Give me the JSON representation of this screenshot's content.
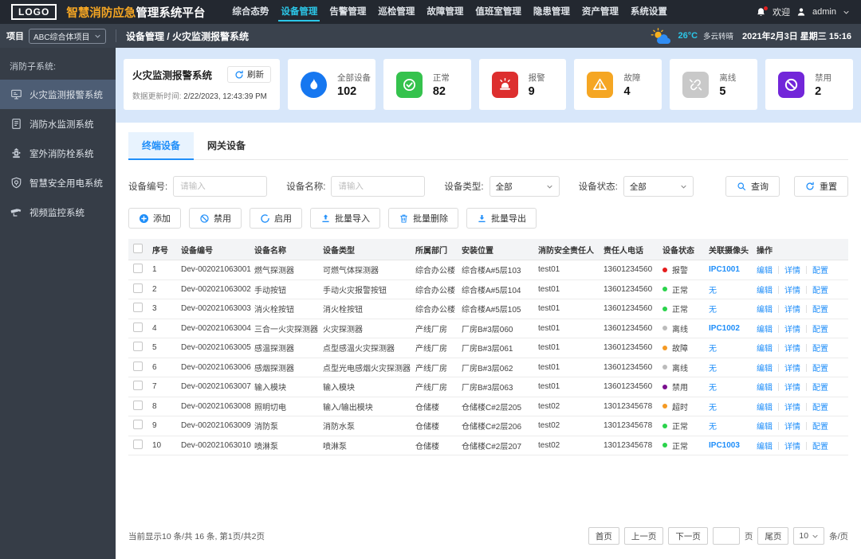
{
  "topnav": {
    "logo": "LOGO",
    "brand_accent": "智慧消防应急",
    "brand_rest": "管理系统平台",
    "menu": [
      {
        "label": "综合态势"
      },
      {
        "label": "设备管理",
        "active": true
      },
      {
        "label": "告警管理"
      },
      {
        "label": "巡检管理"
      },
      {
        "label": "故障管理"
      },
      {
        "label": "值班室管理"
      },
      {
        "label": "隐患管理"
      },
      {
        "label": "资产管理"
      },
      {
        "label": "系统设置"
      }
    ],
    "welcome": "欢迎",
    "username": "admin"
  },
  "subbar": {
    "project_label": "项目",
    "project_value": "ABC综合体项目",
    "breadcrumb": "设备管理 / 火灾监测报警系统",
    "weather_temp": "26°C",
    "weather_desc": "多云转晴",
    "datetime": "2021年2月3日 星期三 15:16"
  },
  "sidebar": {
    "section_label": "消防子系统:",
    "items": [
      {
        "label": "火灾监测报警系统",
        "icon": "monitor",
        "active": true
      },
      {
        "label": "消防水监测系统",
        "icon": "doc"
      },
      {
        "label": "室外消防栓系统",
        "icon": "hydrant"
      },
      {
        "label": "智慧安全用电系统",
        "icon": "shield"
      },
      {
        "label": "视频监控系统",
        "icon": "camera"
      }
    ]
  },
  "overview": {
    "title": "火灾监测报警系统",
    "refresh_label": "刷新",
    "update_label": "数据更新时间:",
    "update_time": "2/22/2023, 12:43:39 PM",
    "stats": [
      {
        "label": "全部设备",
        "value": "102",
        "color": "#1677f0",
        "icon": "flame",
        "is_circle": true
      },
      {
        "label": "正常",
        "value": "82",
        "color": "#35c24d",
        "icon": "check"
      },
      {
        "label": "报警",
        "value": "9",
        "color": "#dd2f2f",
        "icon": "alarm"
      },
      {
        "label": "故障",
        "value": "4",
        "color": "#f5a623",
        "icon": "warn"
      },
      {
        "label": "离线",
        "value": "5",
        "color": "#c9c9c9",
        "icon": "offline"
      },
      {
        "label": "禁用",
        "value": "2",
        "color": "#7226d9",
        "icon": "ban"
      }
    ]
  },
  "tabs": [
    {
      "label": "终端设备",
      "active": true
    },
    {
      "label": "网关设备"
    }
  ],
  "filters": {
    "device_code_label": "设备编号:",
    "device_code_placeholder": "请输入",
    "device_name_label": "设备名称:",
    "device_name_placeholder": "请输入",
    "device_type_label": "设备类型:",
    "device_type_value": "全部",
    "device_status_label": "设备状态:",
    "device_status_value": "全部",
    "query_label": "查询",
    "reset_label": "重置"
  },
  "actions": [
    {
      "label": "添加",
      "icon": "plus"
    },
    {
      "label": "禁用",
      "icon": "ban2"
    },
    {
      "label": "启用",
      "icon": "circ"
    },
    {
      "label": "批量导入",
      "icon": "upload"
    },
    {
      "label": "批量删除",
      "icon": "trash"
    },
    {
      "label": "批量导出",
      "icon": "download"
    }
  ],
  "table": {
    "columns": [
      "序号",
      "设备编号",
      "设备名称",
      "设备类型",
      "所属部门",
      "安装位置",
      "消防安全责任人",
      "责任人电话",
      "设备状态",
      "关联摄像头",
      "操作"
    ],
    "ops": [
      "编辑",
      "详情",
      "配置"
    ],
    "rows": [
      {
        "index": "1",
        "code": "Dev-002021063001",
        "name": "燃气探测器",
        "type": "可燃气体探测器",
        "dept": "综合办公楼",
        "location": "综合楼A#5层103",
        "owner": "test01",
        "phone": "13601234560",
        "status": "报警",
        "status_color": "#e51c1c",
        "camera": "IPC1001",
        "camera_link": true
      },
      {
        "index": "2",
        "code": "Dev-002021063002",
        "name": "手动按钮",
        "type": "手动火灾报警按钮",
        "dept": "综合办公楼",
        "location": "综合楼A#5层104",
        "owner": "test01",
        "phone": "13601234560",
        "status": "正常",
        "status_color": "#2ad34b",
        "camera": "无"
      },
      {
        "index": "3",
        "code": "Dev-002021063003",
        "name": "消火栓按钮",
        "type": "消火栓按钮",
        "dept": "综合办公楼",
        "location": "综合楼A#5层105",
        "owner": "test01",
        "phone": "13601234560",
        "status": "正常",
        "status_color": "#2ad34b",
        "camera": "无"
      },
      {
        "index": "4",
        "code": "Dev-002021063004",
        "name": "三合一火灾探测器",
        "type": "火灾探测器",
        "dept": "产线厂房",
        "location": "厂房B#3层060",
        "owner": "test01",
        "phone": "13601234560",
        "status": "离线",
        "status_color": "#bbbbbb",
        "camera": "IPC1002",
        "camera_link": true
      },
      {
        "index": "5",
        "code": "Dev-002021063005",
        "name": "感温探测器",
        "type": "点型感温火灾探测器",
        "dept": "产线厂房",
        "location": "厂房B#3层061",
        "owner": "test01",
        "phone": "13601234560",
        "status": "故障",
        "status_color": "#f59a23",
        "camera": "无"
      },
      {
        "index": "6",
        "code": "Dev-002021063006",
        "name": "感烟探测器",
        "type": "点型光电感烟火灾探测器",
        "dept": "产线厂房",
        "location": "厂房B#3层062",
        "owner": "test01",
        "phone": "13601234560",
        "status": "离线",
        "status_color": "#bbbbbb",
        "camera": "无"
      },
      {
        "index": "7",
        "code": "Dev-002021063007",
        "name": "输入模块",
        "type": "输入模块",
        "dept": "产线厂房",
        "location": "厂房B#3层063",
        "owner": "test01",
        "phone": "13601234560",
        "status": "禁用",
        "status_color": "#7a0f8e",
        "camera": "无"
      },
      {
        "index": "8",
        "code": "Dev-002021063008",
        "name": "照明切电",
        "type": "输入/输出模块",
        "dept": "仓储楼",
        "location": "仓储楼C#2层205",
        "owner": "test02",
        "phone": "13012345678",
        "status": "超时",
        "status_color": "#f59a23",
        "camera": "无"
      },
      {
        "index": "9",
        "code": "Dev-002021063009",
        "name": "消防泵",
        "type": "消防水泵",
        "dept": "仓储楼",
        "location": "仓储楼C#2层206",
        "owner": "test02",
        "phone": "13012345678",
        "status": "正常",
        "status_color": "#2ad34b",
        "camera": "无"
      },
      {
        "index": "10",
        "code": "Dev-002021063010",
        "name": "喷淋泵",
        "type": "喷淋泵",
        "dept": "仓储楼",
        "location": "仓储楼C#2层207",
        "owner": "test02",
        "phone": "13012345678",
        "status": "正常",
        "status_color": "#2ad34b",
        "camera": "IPC1003",
        "camera_link": true
      }
    ]
  },
  "pagination": {
    "summary": "当前显示10 条/共 16 条, 第1页/共2页",
    "first": "首页",
    "prev": "上一页",
    "next": "下一页",
    "page_label": "页",
    "last": "尾页",
    "page_size": "10",
    "per_label": "条/页"
  }
}
